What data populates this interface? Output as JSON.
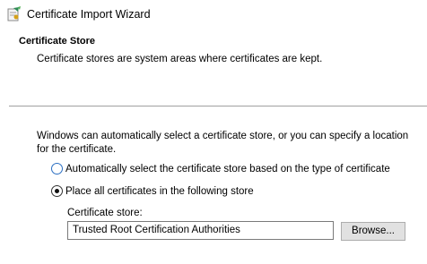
{
  "window": {
    "title": "Certificate Import Wizard",
    "icon": "certificate-wizard-icon"
  },
  "header": {
    "title": "Certificate Store",
    "subtitle": "Certificate stores are system areas where certificates are kept."
  },
  "body": {
    "intro": "Windows can automatically select a certificate store, or you can specify a location for the certificate.",
    "options": [
      {
        "label": "Automatically select the certificate store based on the type of certificate",
        "selected": false
      },
      {
        "label": "Place all certificates in the following store",
        "selected": true
      }
    ],
    "store_label": "Certificate store:",
    "store_value": "Trusted Root Certification Authorities",
    "browse_label": "Browse..."
  },
  "colors": {
    "radio_focus": "#2b6fc2",
    "button_bg": "#e1e1e1",
    "divider": "#a0a0a0"
  }
}
